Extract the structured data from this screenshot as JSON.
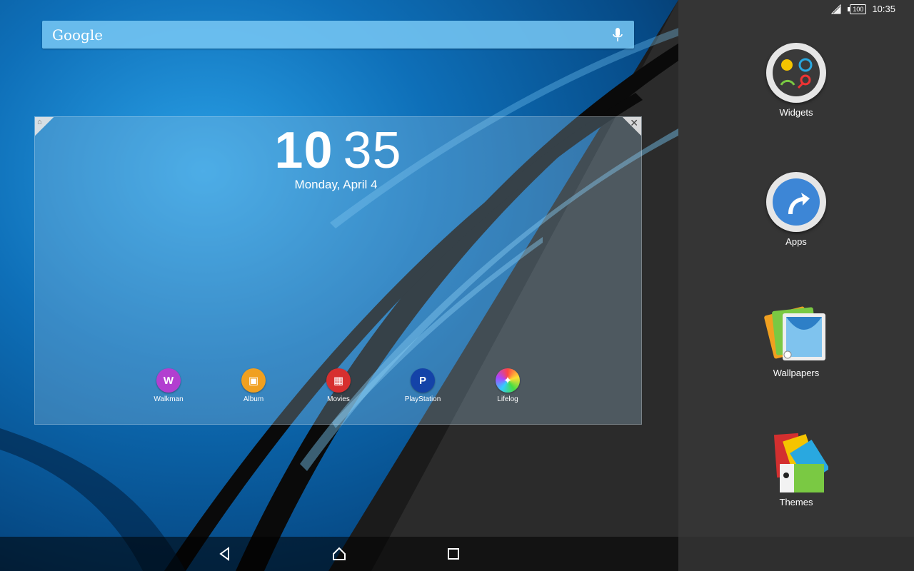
{
  "status": {
    "battery": "100",
    "time": "10:35"
  },
  "search": {
    "logo": "Google"
  },
  "clock": {
    "hours": "10",
    "minutes": "35",
    "date": "Monday, April 4"
  },
  "dock_apps": [
    {
      "label": "Walkman",
      "color": "#b23fd0",
      "glyph": "W"
    },
    {
      "label": "Album",
      "color": "#f0a020",
      "glyph": "▣"
    },
    {
      "label": "Movies",
      "color": "#d72f2f",
      "glyph": "▦"
    },
    {
      "label": "PlayStation",
      "color": "#1443a8",
      "glyph": "P"
    },
    {
      "label": "Lifelog",
      "color": "#e8e8e8",
      "glyph": "✦"
    }
  ],
  "panel": {
    "widgets": "Widgets",
    "apps": "Apps",
    "wallpapers": "Wallpapers",
    "themes": "Themes"
  },
  "colors": {
    "wallpaper_blue": "#0e6fb8",
    "panel_bg": "#353535",
    "search_bg": "#78c8f5"
  }
}
